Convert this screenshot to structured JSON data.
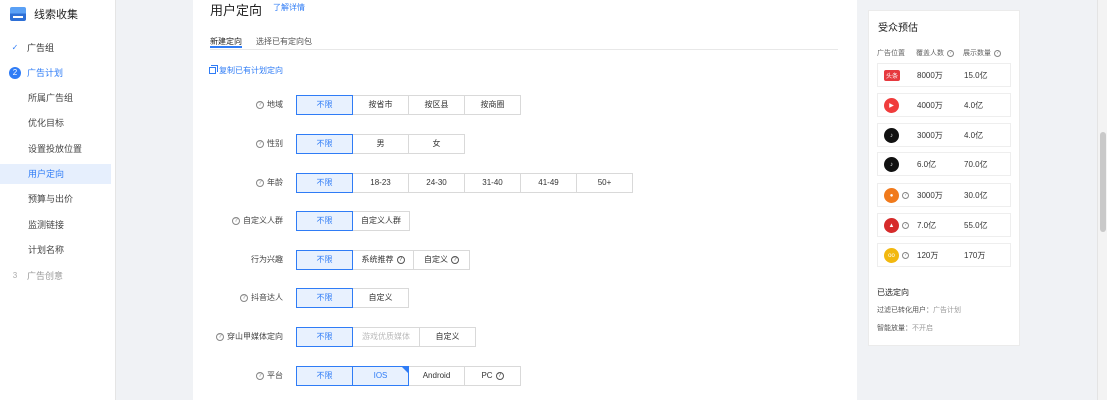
{
  "app": {
    "name": "线索收集"
  },
  "sidebar": {
    "steps": [
      {
        "index": "✓",
        "label": "广告组",
        "state": "done"
      },
      {
        "index": "2",
        "label": "广告计划",
        "state": "active"
      },
      {
        "index": "3",
        "label": "广告创意",
        "state": "todo"
      }
    ],
    "items": [
      {
        "label": "所属广告组"
      },
      {
        "label": "优化目标"
      },
      {
        "label": "设置投放位置"
      },
      {
        "label": "用户定向",
        "active": true
      },
      {
        "label": "预算与出价"
      },
      {
        "label": "监测链接"
      },
      {
        "label": "计划名称"
      }
    ]
  },
  "main": {
    "title": "用户定向",
    "detail_link": "了解详情",
    "tabs": [
      {
        "label": "新建定向",
        "active": true
      },
      {
        "label": "选择已有定向包"
      }
    ],
    "copy_link": "复制已有计划定向",
    "rows": [
      {
        "label": "地域",
        "help": true,
        "options": [
          {
            "label": "不限",
            "selected": true
          },
          {
            "label": "按省市"
          },
          {
            "label": "按区县"
          },
          {
            "label": "按商圈"
          }
        ]
      },
      {
        "label": "性别",
        "help": true,
        "options": [
          {
            "label": "不限",
            "selected": true
          },
          {
            "label": "男"
          },
          {
            "label": "女"
          }
        ]
      },
      {
        "label": "年龄",
        "help": true,
        "options": [
          {
            "label": "不限",
            "selected": true
          },
          {
            "label": "18-23"
          },
          {
            "label": "24-30"
          },
          {
            "label": "31-40"
          },
          {
            "label": "41-49"
          },
          {
            "label": "50+"
          }
        ]
      },
      {
        "label": "自定义人群",
        "help": true,
        "options": [
          {
            "label": "不限",
            "selected": true
          },
          {
            "label": "自定义人群"
          }
        ]
      },
      {
        "label": "行为兴趣",
        "help": false,
        "options": [
          {
            "label": "不限",
            "selected": true
          },
          {
            "label": "系统推荐",
            "help": true
          },
          {
            "label": "自定义",
            "help": true
          }
        ]
      },
      {
        "label": "抖音达人",
        "help": true,
        "options": [
          {
            "label": "不限",
            "selected": true
          },
          {
            "label": "自定义"
          }
        ]
      },
      {
        "label": "穿山甲媒体定向",
        "help": true,
        "options": [
          {
            "label": "不限",
            "selected": true
          },
          {
            "label": "游戏优质媒体",
            "disabled": true
          },
          {
            "label": "自定义"
          }
        ]
      },
      {
        "label": "平台",
        "help": true,
        "options": [
          {
            "label": "不限",
            "selected": true
          },
          {
            "label": "IOS",
            "selected": true
          },
          {
            "label": "Android"
          },
          {
            "label": "PC",
            "help": true
          }
        ]
      }
    ]
  },
  "audience": {
    "title": "受众预估",
    "headers": {
      "position": "广告位置",
      "coverage": "覆盖人数",
      "impressions": "展示数量"
    },
    "rows": [
      {
        "icon": "toutiao-icon",
        "icon_text": "头条",
        "color": "#e6393e",
        "coverage": "8000万",
        "impressions": "15.0亿"
      },
      {
        "icon": "xigua-video-icon",
        "icon_text": "▶",
        "color": "#f03c3c",
        "coverage": "4000万",
        "impressions": "4.0亿"
      },
      {
        "icon": "douyin-icon",
        "icon_text": "♪",
        "color": "#111111",
        "coverage": "3000万",
        "impressions": "4.0亿"
      },
      {
        "icon": "douyin-icon",
        "icon_text": "♪",
        "color": "#111111",
        "coverage": "6.0亿",
        "impressions": "70.0亿"
      },
      {
        "icon": "huoshan-icon",
        "icon_text": "●",
        "color": "#f07a1c",
        "coverage": "3000万",
        "impressions": "30.0亿",
        "help": true
      },
      {
        "icon": "pangolin-icon",
        "icon_text": "▲",
        "color": "#d62b2b",
        "coverage": "7.0亿",
        "impressions": "55.0亿",
        "help": true
      },
      {
        "icon": "coin-icon",
        "icon_text": "oo",
        "color": "#f2b80f",
        "coverage": "120万",
        "impressions": "170万",
        "help": true
      }
    ],
    "selected_title": "已选定向",
    "selected": [
      {
        "key": "过滤已转化用户：",
        "value": "广告计划"
      },
      {
        "key": "智能放量：",
        "value": "不开启"
      }
    ]
  }
}
